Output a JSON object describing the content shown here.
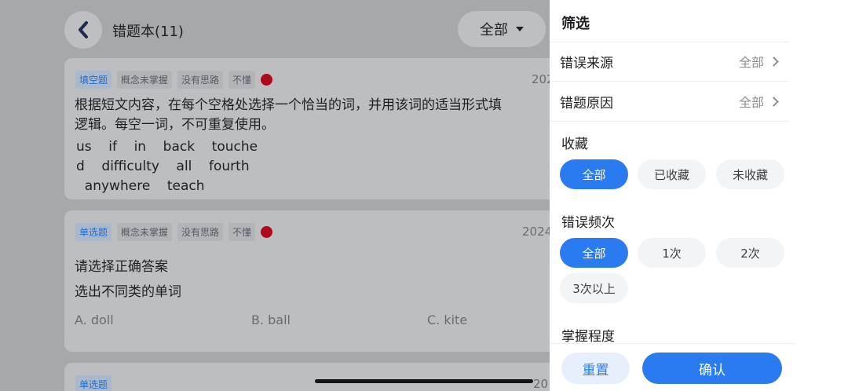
{
  "header": {
    "title": "错题本(11)",
    "filter_label": "全部",
    "back_icon": "chevron-left-icon",
    "caret_icon": "caret-down-icon"
  },
  "cards": [
    {
      "type_tag": "填空题",
      "tags": [
        "概念未掌握",
        "没有思路",
        "不懂"
      ],
      "date": "202",
      "question_lines": [
        "根据短文内容，在每个空格处选择一个恰当的词，并用该词的适当形式填",
        "逻辑。每空一词，不可重复使用。"
      ],
      "word_lines": [
        "us    if    in    back    touche",
        "d    difficulty    all    fourth",
        "  anywhere    teach"
      ]
    },
    {
      "type_tag": "单选题",
      "tags": [
        "概念未掌握",
        "没有思路",
        "不懂"
      ],
      "date": "2024",
      "question_lines": [
        "请选择正确答案",
        "选出不同类的单词"
      ],
      "options": [
        "A. doll",
        "B. ball",
        "C. kite"
      ]
    },
    {
      "type_tag": "单选题",
      "date": "20"
    }
  ],
  "drawer": {
    "title": "筛选",
    "error_source": {
      "label": "错误来源",
      "value": "全部"
    },
    "error_reason": {
      "label": "错题原因",
      "value": "全部"
    },
    "favorite": {
      "label": "收藏",
      "options": [
        "全部",
        "已收藏",
        "未收藏"
      ],
      "selected": "全部"
    },
    "frequency": {
      "label": "错误频次",
      "options": [
        "全部",
        "1次",
        "2次",
        "3次以上"
      ],
      "selected": "全部"
    },
    "mastery": {
      "label": "掌握程度"
    },
    "reset_label": "重置",
    "confirm_label": "确认"
  },
  "colors": {
    "accent": "#2a7bf0",
    "overlay_dim": "#a6a8aa",
    "status_dot": "#ac0a1f"
  }
}
